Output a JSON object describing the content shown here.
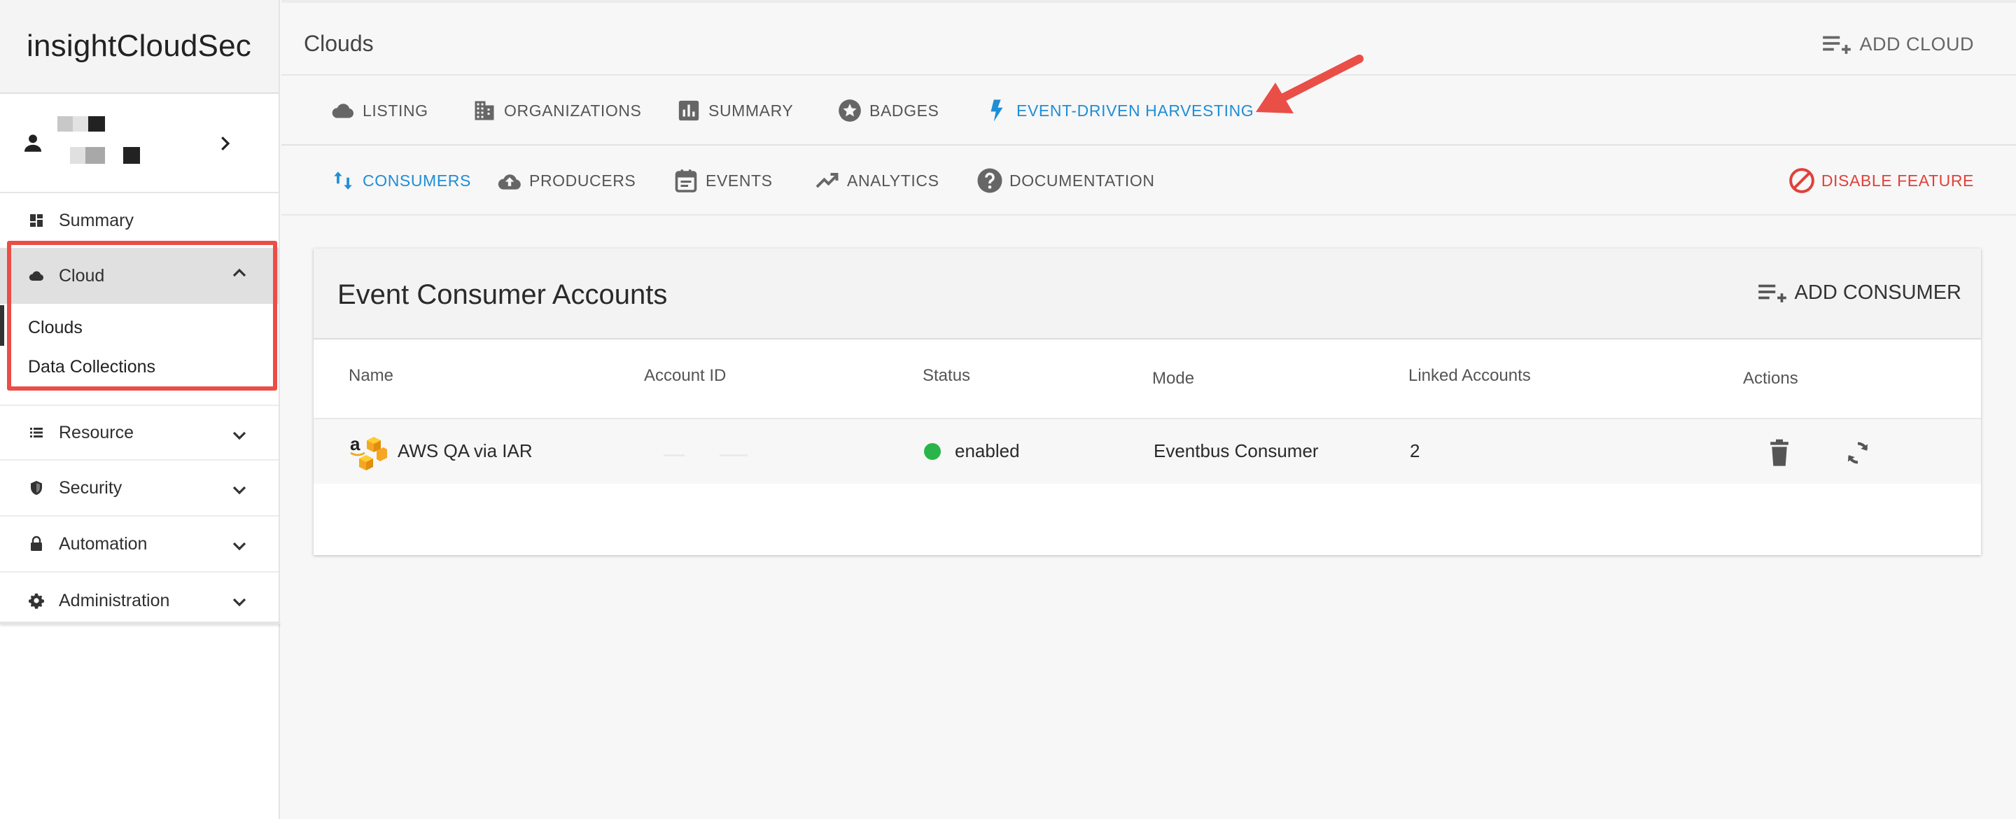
{
  "logo": {
    "light": "insight",
    "bold": "CloudSec"
  },
  "sidebar": {
    "summary": "Summary",
    "cloud": "Cloud",
    "cloud_children": [
      "Clouds",
      "Data Collections"
    ],
    "resource": "Resource",
    "security": "Security",
    "automation": "Automation",
    "administration": "Administration"
  },
  "header": {
    "title": "Clouds",
    "add_cloud": "ADD CLOUD"
  },
  "tabs_primary": [
    "LISTING",
    "ORGANIZATIONS",
    "SUMMARY",
    "BADGES",
    "EVENT-DRIVEN HARVESTING"
  ],
  "tabs_secondary": [
    "CONSUMERS",
    "PRODUCERS",
    "EVENTS",
    "ANALYTICS",
    "DOCUMENTATION"
  ],
  "disable_feature": "DISABLE FEATURE",
  "card": {
    "title": "Event Consumer Accounts",
    "add_consumer": "ADD CONSUMER",
    "columns": [
      "Name",
      "Account ID",
      "Status",
      "Mode",
      "Linked Accounts",
      "Actions"
    ],
    "rows": [
      {
        "name": "AWS QA via IAR",
        "account_id": "",
        "status": "enabled",
        "mode": "Eventbus Consumer",
        "linked_accounts": "2"
      }
    ]
  },
  "colors": {
    "accent": "#1f8ed6",
    "danger": "#e0413a",
    "status_enabled": "#2ab54b",
    "annotation": "#e94e47"
  },
  "icons": [
    "user-icon",
    "chevron-right-icon",
    "dashboard-icon",
    "cloud-icon",
    "chevron-up-icon",
    "chevron-down-icon",
    "list-icon",
    "shield-icon",
    "lock-icon",
    "gear-icon",
    "playlist-add-icon",
    "building-icon",
    "bar-chart-icon",
    "star-badge-icon",
    "bolt-icon",
    "swap-vertical-icon",
    "cloud-upload-icon",
    "calendar-icon",
    "trending-up-icon",
    "help-circle-icon",
    "block-icon",
    "aws-logo",
    "trash-icon",
    "sync-icon"
  ]
}
